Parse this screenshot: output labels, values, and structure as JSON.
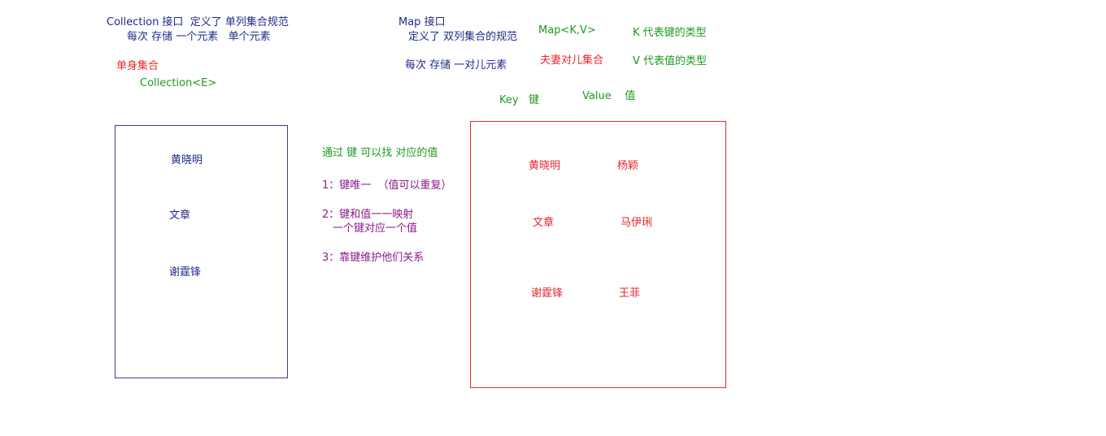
{
  "colors": {
    "navy": "#1f2a8c",
    "red": "#e8262c",
    "green": "#1e9a1e",
    "purple": "#8a1a8a",
    "collection_box": "#3a3aa0",
    "map_box": "#e8262c"
  },
  "collection": {
    "title_line1": "Collection 接口  定义了 单列集合规范",
    "title_line2": "每次 存储 一个元素   单个元素",
    "single_label": "单身集合",
    "generic": "Collection<E>",
    "items": [
      "黄晓明",
      "文章",
      "谢霆锋"
    ]
  },
  "map": {
    "title_line1": "Map 接口",
    "title_line2": "定义了 双列集合的规范",
    "title_line3": "每次 存储 一对儿元素",
    "generic": "Map<K,V>",
    "couple_label": "夫妻对儿集合",
    "k_desc": "K 代表键的类型",
    "v_desc": "V 代表值的类型",
    "key_label": "Key   键",
    "value_label": "Value    值",
    "keys": [
      "黄晓明",
      "文章",
      "谢霆锋"
    ],
    "values": [
      "杨颖",
      "马伊琍",
      "王菲"
    ]
  },
  "notes": {
    "find": "通过 键 可以找 对应的值",
    "rule1": "1：键唯一  （值可以重复）",
    "rule2_line1": "2：键和值一一映射",
    "rule2_line2": "一个键对应一个值",
    "rule3": "3：靠键维护他们关系"
  }
}
